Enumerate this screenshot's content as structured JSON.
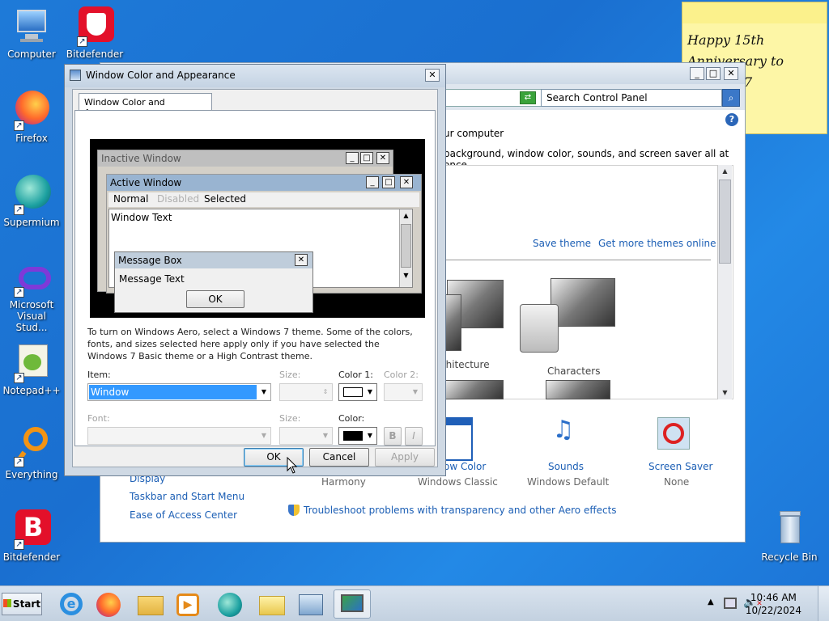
{
  "desktop": {
    "icons": [
      {
        "label": "Computer"
      },
      {
        "label": "Bitdefender"
      },
      {
        "label": "Firefox"
      },
      {
        "label": "Supermium"
      },
      {
        "label": "Microsoft Visual Stud..."
      },
      {
        "label": "Notepad++"
      },
      {
        "label": "Everything"
      },
      {
        "label": "Bitdefender"
      },
      {
        "label": "Recycle Bin"
      }
    ],
    "sticky": {
      "line1": "Happy 15th",
      "line2": "Anniversary to",
      "line3": "7"
    }
  },
  "control_panel": {
    "search_placeholder": "Search Control Panel",
    "heading_fragment": "ur computer",
    "subheading_fragment": "background, window color, sounds, and screen saver all at once.",
    "save_theme": "Save theme",
    "get_more_themes": "Get more themes online",
    "theme_architecture": "chitecture",
    "theme_characters": "Characters",
    "bottom_items": [
      {
        "label": "ow Color",
        "sub": "Windows Classic"
      },
      {
        "label": "Sounds",
        "sub": "Windows Default"
      },
      {
        "label": "Screen Saver",
        "sub": "None"
      }
    ],
    "harmony": "Harmony",
    "sidebar_links": {
      "display": "Display",
      "taskbar": "Taskbar and Start Menu",
      "ease": "Ease of Access Center"
    },
    "troubleshoot": "Troubleshoot problems with transparency and other Aero effects"
  },
  "dialog": {
    "title": "Window Color and Appearance",
    "tab": "Window Color and Appearance",
    "preview": {
      "inactive": "Inactive Window",
      "active": "Active Window",
      "menu_normal": "Normal",
      "menu_disabled": "Disabled",
      "menu_selected": "Selected",
      "window_text": "Window Text",
      "message_box": "Message Box",
      "message_text": "Message Text",
      "ok": "OK"
    },
    "info": "To turn on Windows Aero, select a Windows 7 theme.  Some of the colors, fonts, and sizes selected here apply only if you have selected the Windows 7 Basic theme or a High Contrast theme.",
    "item_label": "Item:",
    "item_value": "Window",
    "size_label": "Size:",
    "color1_label": "Color 1:",
    "color2_label": "Color 2:",
    "font_label": "Font:",
    "size2_label": "Size:",
    "color_label": "Color:",
    "bold": "B",
    "italic": "I",
    "ok": "OK",
    "cancel": "Cancel",
    "apply": "Apply"
  },
  "taskbar": {
    "start": "Start",
    "time": "10:46 AM",
    "date": "10/22/2024"
  },
  "colors": {
    "selection": "#3399ff",
    "link": "#1c5fb5"
  }
}
